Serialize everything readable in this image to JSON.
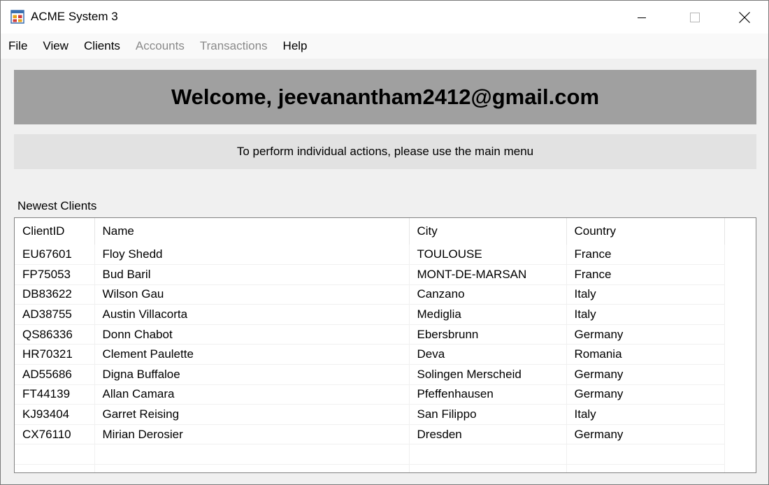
{
  "window": {
    "title": "ACME System 3"
  },
  "menu": [
    {
      "label": "File",
      "enabled": true
    },
    {
      "label": "View",
      "enabled": true
    },
    {
      "label": "Clients",
      "enabled": true
    },
    {
      "label": "Accounts",
      "enabled": false
    },
    {
      "label": "Transactions",
      "enabled": false
    },
    {
      "label": "Help",
      "enabled": true
    }
  ],
  "welcome": {
    "text": "Welcome, jeevanantham2412@gmail.com"
  },
  "info": {
    "text": "To perform individual actions, please use the main menu"
  },
  "clients": {
    "label": "Newest Clients",
    "columns": [
      "ClientID",
      "Name",
      "City",
      "Country"
    ],
    "rows": [
      [
        "EU67601",
        "Floy Shedd",
        "TOULOUSE",
        "France"
      ],
      [
        "FP75053",
        "Bud Baril",
        "MONT-DE-MARSAN",
        "France"
      ],
      [
        "DB83622",
        "Wilson Gau",
        "Canzano",
        "Italy"
      ],
      [
        "AD38755",
        "Austin Villacorta",
        "Mediglia",
        "Italy"
      ],
      [
        "QS86336",
        "Donn Chabot",
        "Ebersbrunn",
        "Germany"
      ],
      [
        "HR70321",
        "Clement Paulette",
        "Deva",
        "Romania"
      ],
      [
        "AD55686",
        "Digna Buffaloe",
        "Solingen Merscheid",
        "Germany"
      ],
      [
        "FT44139",
        "Allan Camara",
        "Pfeffenhausen",
        "Germany"
      ],
      [
        "KJ93404",
        "Garret Reising",
        "San Filippo",
        "Italy"
      ],
      [
        "CX76110",
        "Mirian Derosier",
        "Dresden",
        "Germany"
      ]
    ]
  },
  "colors": {
    "welcome_bg": "#a0a0a0",
    "info_bg": "#e2e2e2",
    "disabled_menu": "#8a8a8a"
  }
}
